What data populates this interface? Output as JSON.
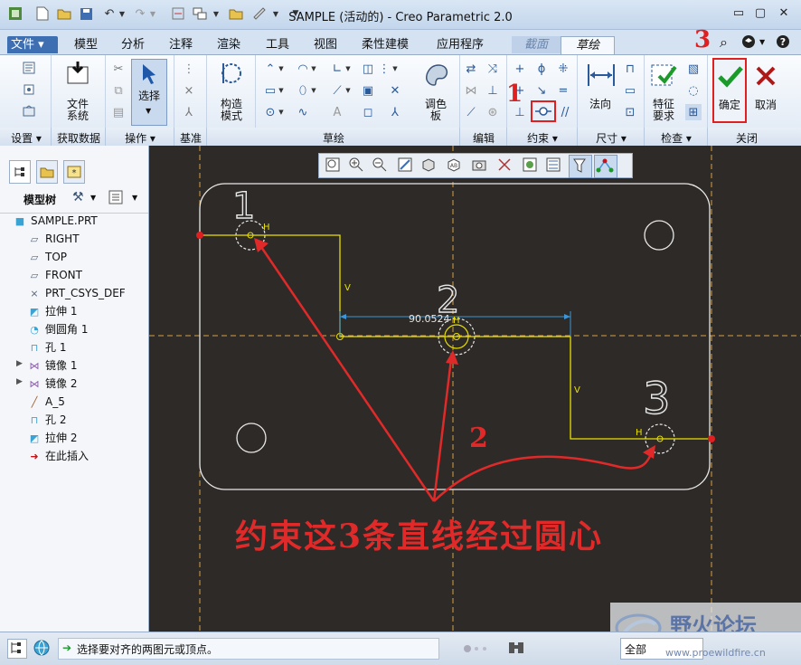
{
  "window": {
    "title": "SAMPLE (活动的) - Creo Parametric 2.0"
  },
  "tabs": [
    {
      "label": "文件"
    },
    {
      "label": "模型"
    },
    {
      "label": "分析"
    },
    {
      "label": "注释"
    },
    {
      "label": "渲染"
    },
    {
      "label": "工具"
    },
    {
      "label": "视图"
    },
    {
      "label": "柔性建模"
    },
    {
      "label": "应用程序"
    },
    {
      "label": "截面"
    },
    {
      "label": "草绘"
    }
  ],
  "ribbon": {
    "file_system": "文件\n系统",
    "select": "选择",
    "construct_mode": "构造\n模式",
    "palette": "调色\n板",
    "normal": "法向",
    "feature_req": "特征\n要求",
    "ok": "确定",
    "cancel": "取消"
  },
  "groups": [
    "设置",
    "获取数据",
    "操作",
    "基准",
    "草绘",
    "编辑",
    "约束",
    "尺寸",
    "检查",
    "关闭"
  ],
  "model_tree": {
    "header": "模型树",
    "items": [
      {
        "label": "SAMPLE.PRT",
        "icon": "part-icon"
      },
      {
        "label": "RIGHT",
        "icon": "plane-icon"
      },
      {
        "label": "TOP",
        "icon": "plane-icon"
      },
      {
        "label": "FRONT",
        "icon": "plane-icon"
      },
      {
        "label": "PRT_CSYS_DEF",
        "icon": "csys-icon"
      },
      {
        "label": "拉伸 1",
        "icon": "extrude-icon"
      },
      {
        "label": "倒圆角 1",
        "icon": "round-icon"
      },
      {
        "label": "孔 1",
        "icon": "hole-icon"
      },
      {
        "label": "镜像 1",
        "icon": "mirror-icon"
      },
      {
        "label": "镜像 2",
        "icon": "mirror-icon"
      },
      {
        "label": "A_5",
        "icon": "axis-icon"
      },
      {
        "label": "孔 2",
        "icon": "hole-icon"
      },
      {
        "label": "拉伸 2",
        "icon": "extrude-icon"
      },
      {
        "label": "在此插入",
        "icon": "insert-arrow-icon"
      }
    ]
  },
  "sketch": {
    "dimension": "90.0524",
    "label_v": "V",
    "label_h": "H",
    "marker_1": "1",
    "marker_2": "2",
    "marker_3": "3"
  },
  "annotations": {
    "step1": "1",
    "step2": "2",
    "step3": "3",
    "caption": "约束这3条直线经过圆心"
  },
  "status": {
    "message": "选择要对齐的两图元或顶点。",
    "filter": "全部"
  },
  "watermark": {
    "name": "野火论坛",
    "url": "www.proewildfire.cn"
  },
  "colors": {
    "accent": "#3e6fb2",
    "canvas": "#2d2a27",
    "sketch": "#e8e800",
    "annotation": "#e02a2a"
  }
}
